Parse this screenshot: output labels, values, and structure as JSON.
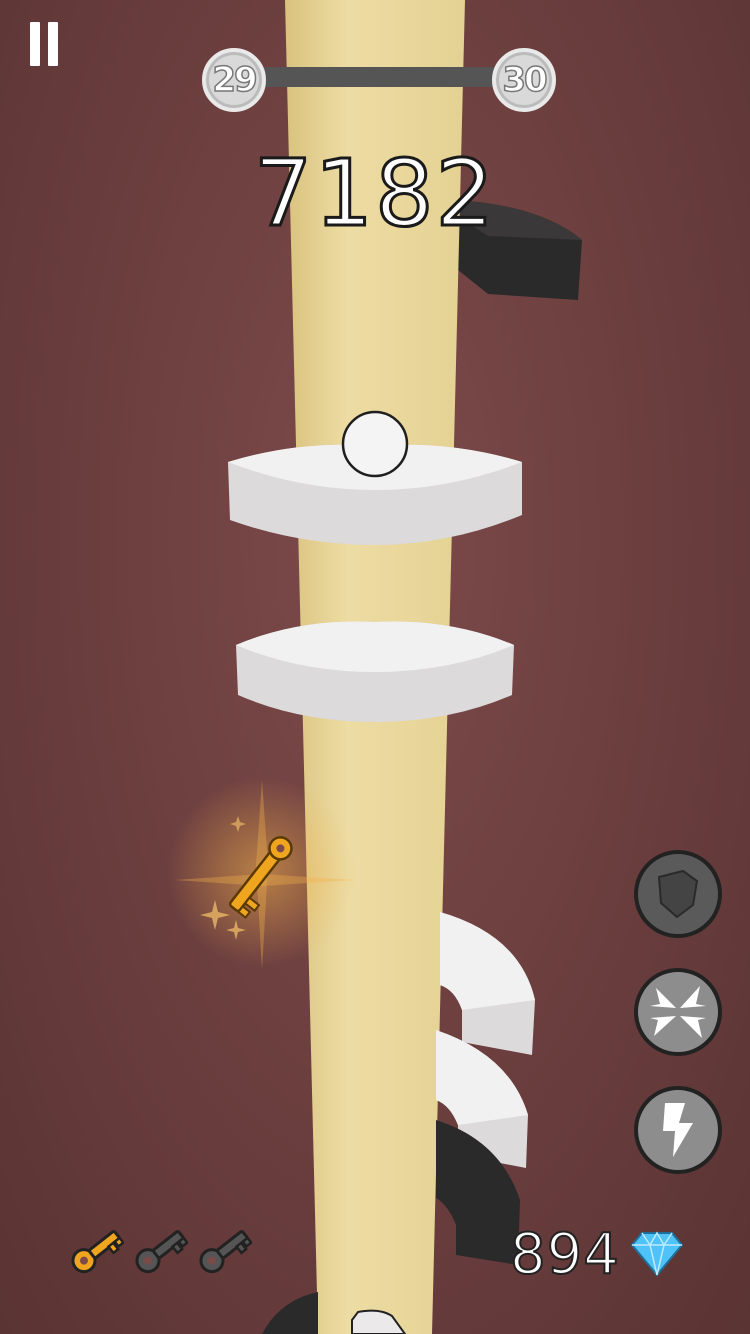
{
  "level": {
    "current": "29",
    "next": "30",
    "progress": 0.0
  },
  "score": "7182",
  "keys": {
    "collected": 1,
    "total": 3
  },
  "gems": {
    "count": "894"
  },
  "powerups": [
    "shield-icon",
    "burst-icon",
    "lightning-icon"
  ],
  "colors": {
    "background": "#6e4040",
    "pillar": "#e6d396",
    "platform": "#ebe9e9",
    "hazard": "#2e2c2c",
    "key_gold": "#f0a51e",
    "key_gray": "#555555",
    "gem": "#4fc3f7"
  }
}
